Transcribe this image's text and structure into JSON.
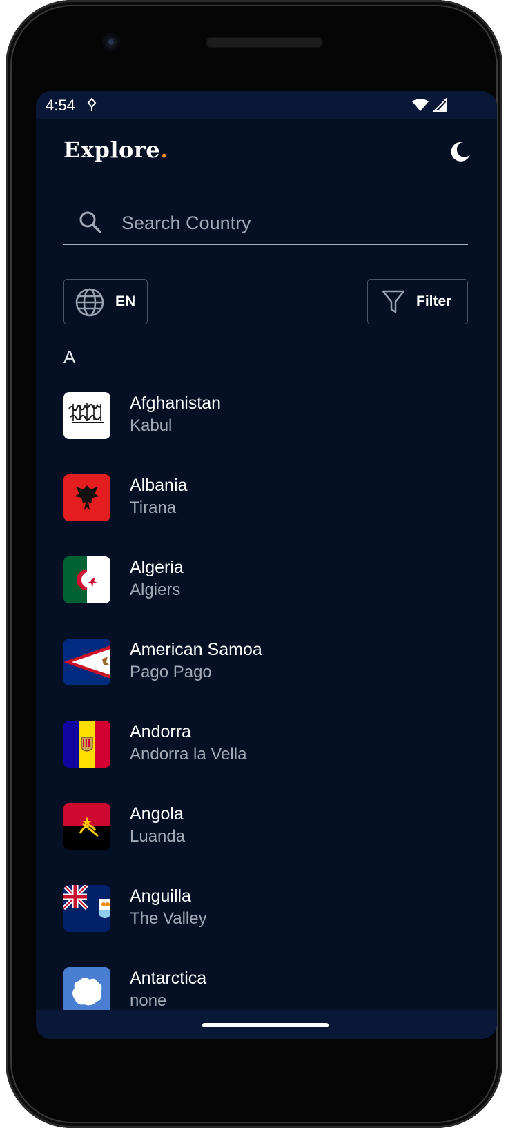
{
  "status_bar": {
    "time": "4:54"
  },
  "header": {
    "logo_text": "Explore",
    "logo_dot": ".",
    "accent_color": "#f08a24",
    "theme_toggle_icon": "moon-icon"
  },
  "search": {
    "placeholder": "Search Country",
    "value": ""
  },
  "controls": {
    "language_label": "EN",
    "filter_label": "Filter"
  },
  "list": {
    "section_letter": "A",
    "countries": [
      {
        "name": "Afghanistan",
        "capital": "Kabul"
      },
      {
        "name": "Albania",
        "capital": "Tirana"
      },
      {
        "name": "Algeria",
        "capital": "Algiers"
      },
      {
        "name": "American Samoa",
        "capital": "Pago Pago"
      },
      {
        "name": "Andorra",
        "capital": "Andorra la Vella"
      },
      {
        "name": "Angola",
        "capital": "Luanda"
      },
      {
        "name": "Anguilla",
        "capital": "The Valley"
      },
      {
        "name": "Antarctica",
        "capital": "none"
      }
    ]
  },
  "colors": {
    "background": "#051024",
    "bars": "#0a1837",
    "secondary_text": "#a3a9b6"
  }
}
